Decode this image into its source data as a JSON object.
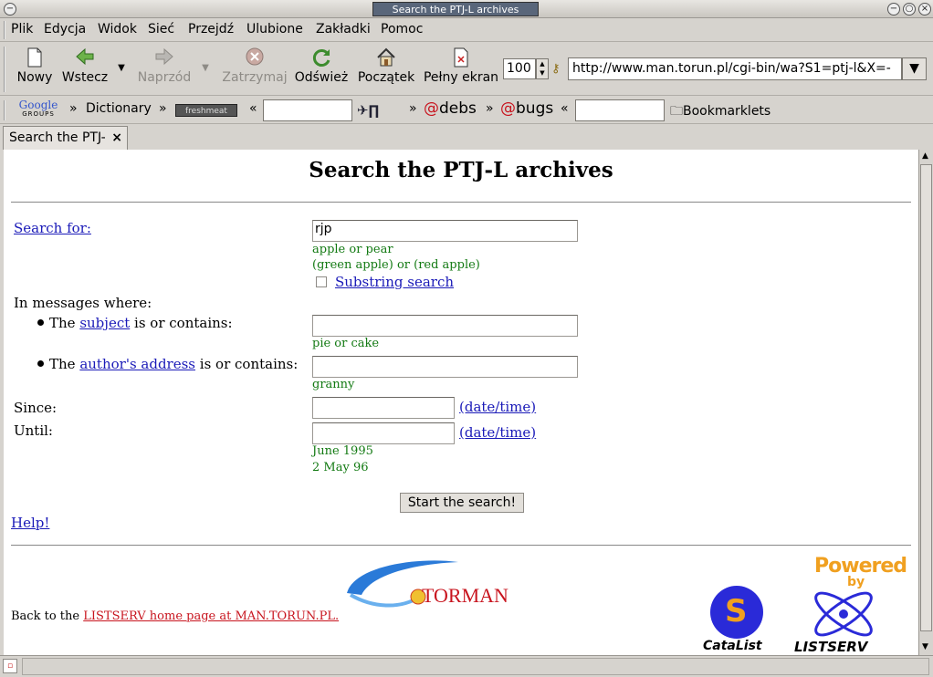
{
  "window": {
    "title": "Search the PTJ-L archives"
  },
  "menu": [
    "Plik",
    "Edycja",
    "Widok",
    "Sieć",
    "Przejdź",
    "Ulubione",
    "Zakładki",
    "Pomoc"
  ],
  "nav": {
    "new": "Nowy",
    "back": "Wstecz",
    "forward": "Naprzód",
    "stop": "Zatrzymaj",
    "reload": "Odśwież",
    "home": "Początek",
    "fullscreen": "Pełny ekran",
    "zoom": "100",
    "url": "http://www.man.torun.pl/cgi-bin/wa?S1=ptj-l&X=-"
  },
  "bookmarks": {
    "google_top": "Google",
    "google_bottom": "GROUPS",
    "dictionary": "Dictionary",
    "freshmeat": "freshmeat",
    "debs": "debs",
    "bugs": "bugs",
    "bookmarklets": "Bookmarklets",
    "sep1": "»",
    "sep2": "»",
    "sep3": "«",
    "sep4": "»",
    "sep5": "»",
    "sep6": "«"
  },
  "tab": {
    "label": "Search the PTJ-",
    "close": "×"
  },
  "page": {
    "heading": "Search the PTJ-L archives",
    "search_for": "Search for:",
    "search_value": "rjp",
    "hint1": "apple or pear",
    "hint2": "(green apple) or (red apple)",
    "substring": "Substring search",
    "in_messages": "In messages where:",
    "the1": "The",
    "subject": "subject",
    "is_contains1": "is or contains:",
    "hint_subject": "pie or cake",
    "the2": "The",
    "author": "author's address",
    "is_contains2": "is or contains:",
    "hint_author": "granny",
    "since": "Since:",
    "until": "Until:",
    "datetime1": "(date/time)",
    "datetime2": "(date/time)",
    "hint_date1": "June 1995",
    "hint_date2": "2 May 96",
    "start": "Start the search!",
    "help": "Help!",
    "back_to": "Back to the",
    "listserv_link": "LISTSERV home page at MAN.TORUN.PL.",
    "torman": "TORMAN",
    "powered": "Powered",
    "by": "by",
    "catalist": "CataList",
    "listserv": "LISTSERV"
  },
  "colors": {
    "link": "#1a1ab8",
    "hint": "#137a13",
    "red_link": "#c8141e",
    "powered": "#f0a020"
  }
}
